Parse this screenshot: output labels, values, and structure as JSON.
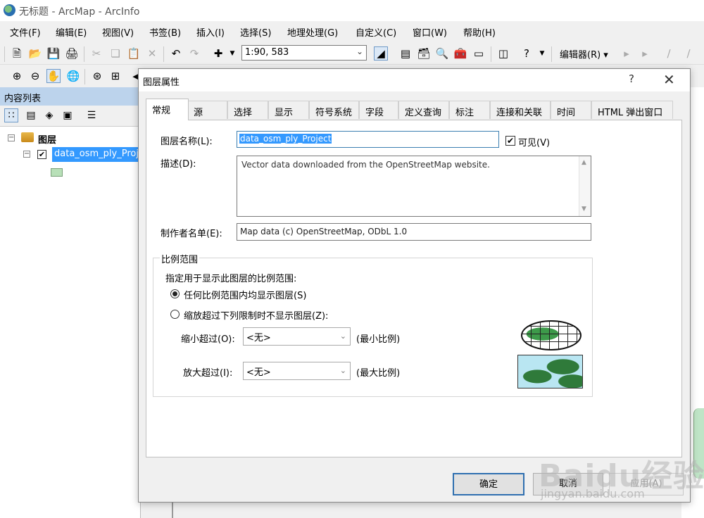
{
  "app": {
    "title": "无标题 - ArcMap - ArcInfo"
  },
  "menu": [
    "文件(F)",
    "编辑(E)",
    "视图(V)",
    "书签(B)",
    "插入(I)",
    "选择(S)",
    "地理处理(G)",
    "自定义(C)",
    "窗口(W)",
    "帮助(H)"
  ],
  "toolbar": {
    "scale": "1:90, 583",
    "editor": "编辑器(R) ▾"
  },
  "toc": {
    "title": "内容列表",
    "root": "图层",
    "layer": "data_osm_ply_Project"
  },
  "dialog": {
    "title": "图层属性",
    "help": "?",
    "close": "✕",
    "tabs": [
      "常规",
      "源",
      "选择",
      "显示",
      "符号系统",
      "字段",
      "定义查询",
      "标注",
      "连接和关联",
      "时间",
      "HTML 弹出窗口"
    ],
    "active_tab": 0,
    "layer_name_label": "图层名称(L):",
    "layer_name": "data_osm_ply_Project",
    "visible_label": "可见(V)",
    "visible": true,
    "description_label": "描述(D):",
    "description": "Vector data downloaded from the OpenStreetMap website.",
    "credits_label": "制作者名单(E):",
    "credits": "Map data (c) OpenStreetMap, ODbL 1.0",
    "scale_range": {
      "legend": "比例范围",
      "instruction": "指定用于显示此图层的比例范围:",
      "option_any": "任何比例范围内均显示图层(S)",
      "option_limit": "缩放超过下列限制时不显示图层(Z):",
      "selected": "any",
      "min_label": "缩小超过(O):",
      "min_value": "<无>",
      "min_hint": "(最小比例)",
      "max_label": "放大超过(I):",
      "max_value": "<无>",
      "max_hint": "(最大比例)"
    },
    "buttons": {
      "ok": "确定",
      "cancel": "取消",
      "apply": "应用(A)"
    }
  },
  "watermark": {
    "main": "Baidu经验",
    "sub": "jingyan.baidu.com"
  }
}
